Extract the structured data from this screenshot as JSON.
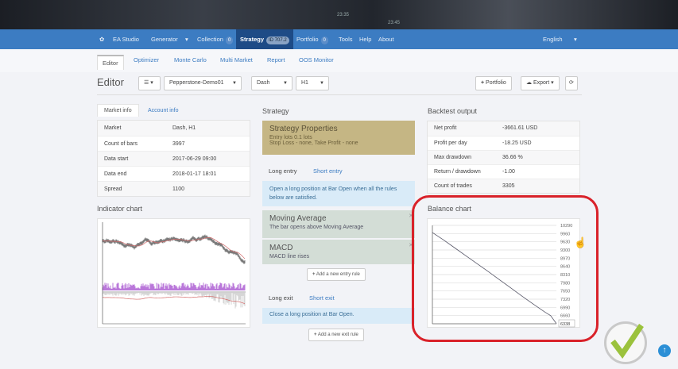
{
  "background_numbers": [
    "23:35",
    "23:45"
  ],
  "nav": {
    "brand": "EA Studio",
    "generator": "Generator",
    "collection": "Collection",
    "collection_count": "0",
    "strategy": "Strategy",
    "strategy_id": "ID 707.2",
    "portfolio": "Portfolio",
    "portfolio_count": "0",
    "tools": "Tools",
    "help": "Help",
    "about": "About",
    "language": "English"
  },
  "subnav": {
    "tabs": [
      "Editor",
      "Optimizer",
      "Monte Carlo",
      "Multi Market",
      "Report",
      "OOS Monitor"
    ]
  },
  "toolbar": {
    "title": "Editor",
    "account": "Pepperstone-Demo01",
    "symbol": "Dash",
    "period": "H1",
    "portfolio_btn": "Portfolio",
    "export_btn": "Export"
  },
  "market": {
    "tabs": [
      "Market info",
      "Account info"
    ],
    "rows": [
      [
        "Market",
        "Dash, H1"
      ],
      [
        "Count of bars",
        "3997"
      ],
      [
        "Data start",
        "2017-06-29 09:00"
      ],
      [
        "Data end",
        "2018-01-17 18:01"
      ],
      [
        "Spread",
        "1100"
      ]
    ]
  },
  "indicator_chart": {
    "title": "Indicator chart"
  },
  "strategy": {
    "title": "Strategy",
    "props_title": "Strategy Properties",
    "props_line1": "Entry lots 0.1 lots",
    "props_line2": "Stop Loss - none, Take Profit - none",
    "long_entry": "Long entry",
    "short_entry": "Short entry",
    "entry_desc": "Open a long position at Bar Open when all the rules below are satisfied.",
    "rules": [
      {
        "name": "Moving Average",
        "desc": "The bar opens above Moving Average"
      },
      {
        "name": "MACD",
        "desc": "MACD line rises"
      }
    ],
    "add_entry": "Add a new entry rule",
    "long_exit": "Long exit",
    "short_exit": "Short exit",
    "exit_desc": "Close a long position at Bar Open.",
    "add_exit": "Add a new exit rule"
  },
  "backtest": {
    "title": "Backtest output",
    "rows": [
      [
        "Net profit",
        "-3661.61 USD"
      ],
      [
        "Profit per day",
        "-18.25 USD"
      ],
      [
        "Max drawdown",
        "36.66 %"
      ],
      [
        "Return / drawdown",
        "-1.00"
      ],
      [
        "Count of trades",
        "3305"
      ]
    ]
  },
  "balance_chart": {
    "title": "Balance chart",
    "hover_label": "6338"
  },
  "chart_data": {
    "type": "line",
    "title": "Balance chart",
    "ylim": [
      6330,
      10290
    ],
    "yticks": [
      10290,
      9960,
      9630,
      9300,
      8970,
      8640,
      8310,
      7980,
      7650,
      7320,
      6990,
      6660,
      6330
    ],
    "grid": true,
    "x": [
      0,
      300,
      600,
      900,
      1200,
      1500,
      1800,
      2100,
      2400,
      2700,
      3000,
      3150,
      3305
    ],
    "values": [
      10000,
      9700,
      9380,
      9060,
      8740,
      8420,
      8090,
      7760,
      7430,
      7110,
      6800,
      6660,
      6338
    ]
  },
  "colors": {
    "nav": "#3c7cc2",
    "active_nav": "#1e4b86",
    "highlight": "#d9222a"
  }
}
